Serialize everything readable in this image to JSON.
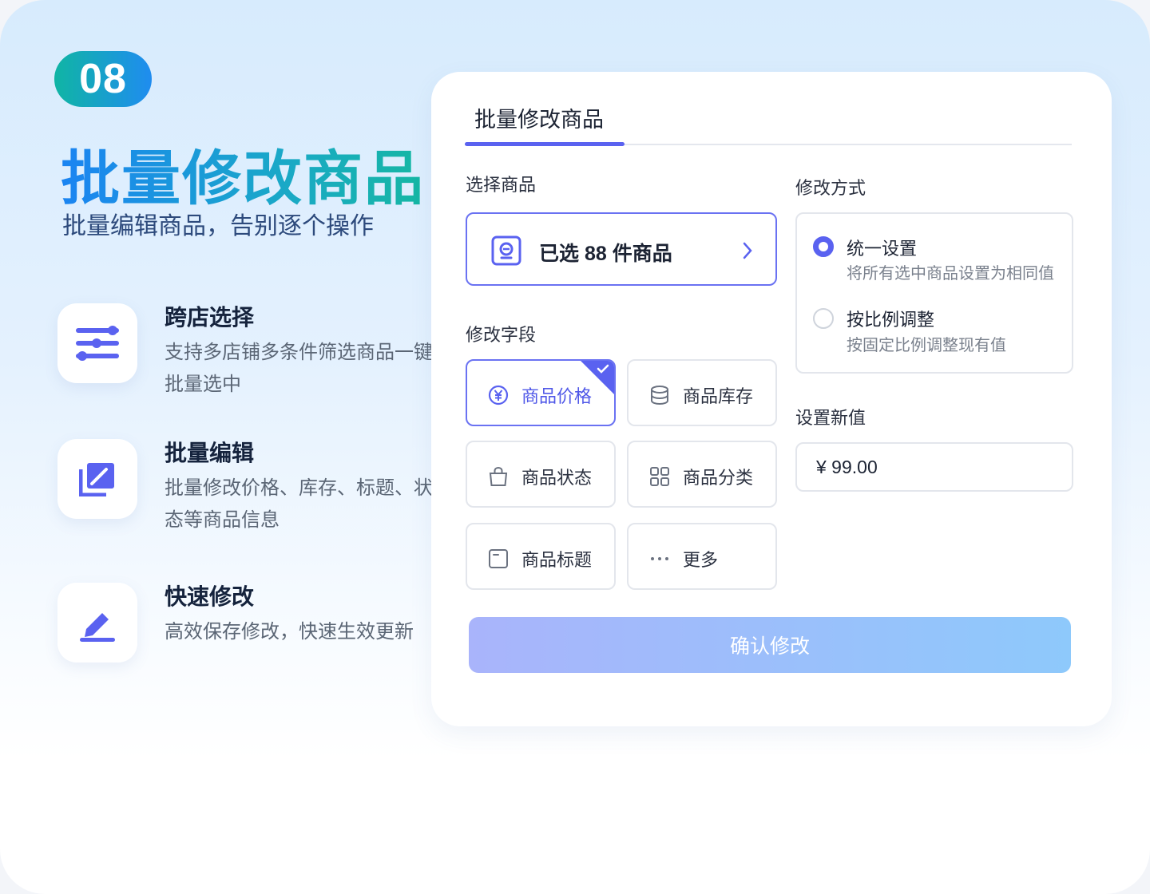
{
  "badge": "08",
  "hero": {
    "title": "批量修改商品",
    "subtitle": "批量编辑商品，告别逐个操作"
  },
  "features": [
    {
      "title": "跨店选择",
      "desc": "支持多店铺多条件筛选商品一键批量选中",
      "icon": "sliders-icon"
    },
    {
      "title": "批量编辑",
      "desc": "批量修改价格、库存、标题、状态等商品信息",
      "icon": "batch-edit-icon"
    },
    {
      "title": "快速修改",
      "desc": "高效保存修改，快速生效更新",
      "icon": "pencil-icon"
    }
  ],
  "panel": {
    "tab_title": "批量修改商品",
    "select_label": "选择商品",
    "selected_text": "已选 88 件商品",
    "fields_label": "修改字段",
    "fields": [
      {
        "label": "商品价格",
        "icon": "yuan-icon",
        "active": true
      },
      {
        "label": "商品库存",
        "icon": "database-icon",
        "active": false
      },
      {
        "label": "商品状态",
        "icon": "bag-icon",
        "active": false
      },
      {
        "label": "商品分类",
        "icon": "grid-icon",
        "active": false
      },
      {
        "label": "商品标题",
        "icon": "title-icon",
        "active": false
      },
      {
        "label": "更多",
        "icon": "more-icon",
        "active": false
      }
    ],
    "mode_label": "修改方式",
    "modes": [
      {
        "title": "统一设置",
        "desc": "将所有选中商品设置为相同值",
        "selected": true
      },
      {
        "title": "按比例调整",
        "desc": "按固定比例调整现有值",
        "selected": false
      }
    ],
    "new_value_label": "设置新值",
    "new_value": "¥  99.00",
    "confirm_label": "确认修改"
  },
  "colors": {
    "accent": "#5a62f0",
    "badge_start": "#10b5a4",
    "badge_end": "#1f8cf0",
    "confirm_start": "#a9b4fb",
    "confirm_end": "#8ec9fb"
  }
}
